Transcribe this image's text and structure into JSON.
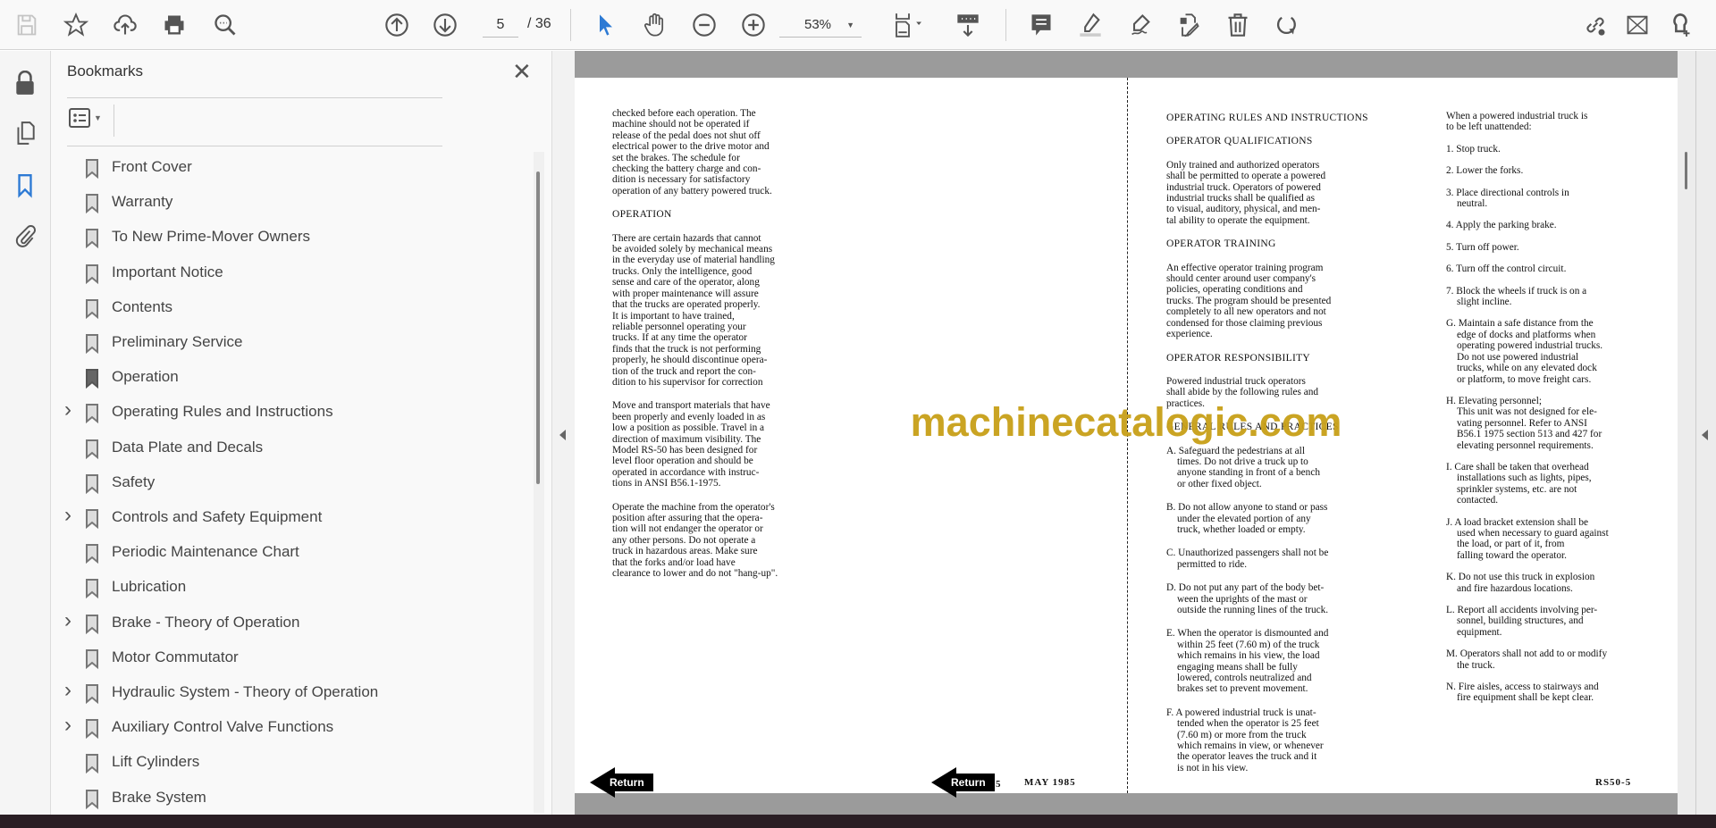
{
  "toolbar": {
    "page_current": "5",
    "page_total": "/ 36",
    "zoom": "53%"
  },
  "colors": {
    "accent": "#2d7ad4",
    "watermark": "#c8a018"
  },
  "panel": {
    "title": "Bookmarks",
    "bookmarks": [
      {
        "label": "Front Cover",
        "expandable": false
      },
      {
        "label": "Warranty",
        "expandable": false
      },
      {
        "label": "To New Prime-Mover Owners",
        "expandable": false
      },
      {
        "label": "Important Notice",
        "expandable": false
      },
      {
        "label": "Contents",
        "expandable": false
      },
      {
        "label": "Preliminary Service",
        "expandable": false
      },
      {
        "label": "Operation",
        "expandable": false,
        "current": true
      },
      {
        "label": "Operating Rules and Instructions",
        "expandable": true
      },
      {
        "label": "Data Plate and Decals",
        "expandable": false
      },
      {
        "label": "Safety",
        "expandable": false
      },
      {
        "label": "Controls and Safety Equipment",
        "expandable": true
      },
      {
        "label": "Periodic Maintenance Chart",
        "expandable": false
      },
      {
        "label": "Lubrication",
        "expandable": false
      },
      {
        "label": "Brake - Theory of Operation",
        "expandable": true
      },
      {
        "label": "Motor Commutator",
        "expandable": false
      },
      {
        "label": "Hydraulic System - Theory of Operation",
        "expandable": true
      },
      {
        "label": "Auxiliary Control Valve Functions",
        "expandable": true
      },
      {
        "label": "Lift Cylinders",
        "expandable": false
      },
      {
        "label": "Brake System",
        "expandable": false
      }
    ]
  },
  "document": {
    "watermark": "machinecatalogic.com",
    "return_label": "Return",
    "left_footer": "MAY 1985",
    "right_footer_partial": "5",
    "right_footer": "RS50-5",
    "left_page": [
      {
        "type": "p",
        "lines": [
          "checked before each operation. The",
          "machine should not be operated if",
          "release of the pedal does not shut off",
          "electrical power to the drive motor and",
          "set the brakes. The schedule for",
          "checking the battery charge and con-",
          "dition is necessary for satisfactory",
          "operation of any battery powered truck."
        ]
      },
      {
        "type": "h",
        "lines": [
          "OPERATION"
        ]
      },
      {
        "type": "p",
        "lines": [
          "There are certain hazards that cannot",
          "be avoided solely by mechanical means",
          "in the everyday use of material handling",
          "trucks. Only the intelligence, good",
          "sense and care of the operator, along",
          "with proper maintenance will assure",
          "that the trucks are operated properly.",
          "It is important to have trained,",
          "reliable personnel operating your",
          "trucks. If at any time the operator",
          "finds that the truck is not performing",
          "properly, he should discontinue opera-",
          "tion of the truck and report the con-",
          "dition to his supervisor for correction"
        ]
      },
      {
        "type": "p",
        "lines": [
          "Move and transport materials that have",
          "been properly and evenly loaded in as",
          "low a position as possible. Travel in a",
          "direction of maximum visibility. The",
          "Model RS-50 has been designed for",
          "level floor operation and should be",
          "operated in accordance with instruc-",
          "tions in ANSI B56.1-1975."
        ]
      },
      {
        "type": "p",
        "lines": [
          "Operate the machine from the operator's",
          "position after assuring that the opera-",
          "tion will not endanger the operator or",
          "any other persons. Do not operate a",
          "truck in hazardous areas. Make sure",
          "that the forks and/or load have",
          "clearance to lower and do not \"hang-up\"."
        ]
      }
    ],
    "right_col1": [
      {
        "type": "h",
        "lines": [
          "OPERATING RULES AND INSTRUCTIONS"
        ]
      },
      {
        "type": "h",
        "lines": [
          "OPERATOR QUALIFICATIONS"
        ]
      },
      {
        "type": "p",
        "lines": [
          "Only trained and authorized operators",
          "shall be permitted to operate a powered",
          "industrial truck.  Operators of powered",
          "industrial trucks shall be qualified as",
          "to visual, auditory, physical, and men-",
          "tal ability to operate the equipment."
        ]
      },
      {
        "type": "h",
        "lines": [
          "OPERATOR TRAINING"
        ]
      },
      {
        "type": "p",
        "lines": [
          "An effective operator training program",
          "should center around user company's",
          "policies, operating conditions and",
          "trucks. The program should be presented",
          "completely to all new operators and not",
          "condensed for those claiming previous",
          "experience."
        ]
      },
      {
        "type": "h",
        "lines": [
          "OPERATOR RESPONSIBILITY"
        ]
      },
      {
        "type": "p",
        "lines": [
          "Powered industrial truck operators",
          "shall abide by the following rules and",
          "practices."
        ]
      },
      {
        "type": "h",
        "lines": [
          "GENERAL RULES AND PRACTICES"
        ]
      },
      {
        "type": "i",
        "lines": [
          "A. Safeguard the pedestrians at all",
          "times. Do not drive a truck up to",
          "anyone standing in front of a bench",
          "or other fixed object."
        ]
      },
      {
        "type": "i",
        "lines": [
          "B. Do not allow anyone to stand or pass",
          "under the elevated portion of any",
          "truck, whether loaded or empty."
        ]
      },
      {
        "type": "i",
        "lines": [
          "C. Unauthorized passengers shall not be",
          "permitted to ride."
        ]
      },
      {
        "type": "i",
        "lines": [
          "D. Do not put any part of the body bet-",
          "ween the uprights of the mast or",
          "outside the running lines of the truck."
        ]
      },
      {
        "type": "i",
        "lines": [
          "E. When the operator is dismounted and",
          "within 25 feet (7.60 m) of the truck",
          "which remains in his view, the load",
          "engaging means shall be fully",
          "lowered, controls neutralized and",
          "brakes set to prevent movement."
        ]
      },
      {
        "type": "i",
        "lines": [
          "F. A powered industrial truck is unat-",
          "tended when the operator is 25 feet",
          "(7.60 m) or more from the truck",
          "which remains in view, or whenever",
          "the operator leaves the truck and it",
          "is not in his view."
        ]
      }
    ],
    "right_col2": [
      {
        "type": "p",
        "lines": [
          "When a powered industrial truck is",
          "to be left unattended:"
        ]
      },
      {
        "type": "i",
        "lines": [
          "1. Stop truck."
        ]
      },
      {
        "type": "i",
        "lines": [
          "2. Lower the forks."
        ]
      },
      {
        "type": "i",
        "lines": [
          "3. Place directional controls in",
          "neutral."
        ]
      },
      {
        "type": "i",
        "lines": [
          "4. Apply the parking brake."
        ]
      },
      {
        "type": "i",
        "lines": [
          "5. Turn off power."
        ]
      },
      {
        "type": "i",
        "lines": [
          "6. Turn off the control circuit."
        ]
      },
      {
        "type": "i",
        "lines": [
          "7. Block the wheels if truck is on a",
          "slight incline."
        ]
      },
      {
        "type": "i",
        "lines": [
          "G. Maintain a safe distance from the",
          "edge of docks and platforms when",
          "operating powered industrial trucks.",
          "Do not use powered industrial",
          "trucks, while on any elevated dock",
          "or platform, to move freight cars."
        ]
      },
      {
        "type": "i",
        "lines": [
          "H. Elevating personnel;",
          "This unit was not designed for ele-",
          "vating personnel. Refer to ANSI",
          "B56.1  1975 section 513 and 427 for",
          "elevating personnel requirements."
        ]
      },
      {
        "type": "i",
        "lines": [
          "I. Care shall be taken that overhead",
          "installations such as lights, pipes,",
          "sprinkler systems, etc. are not",
          "contacted."
        ]
      },
      {
        "type": "i",
        "lines": [
          "J. A load bracket extension shall be",
          "used when necessary to guard against",
          "the load, or part of it, from",
          "falling toward the operator."
        ]
      },
      {
        "type": "i",
        "lines": [
          "K. Do not use this truck in explosion",
          "and fire hazardous locations."
        ]
      },
      {
        "type": "i",
        "lines": [
          "L. Report all accidents involving per-",
          "sonnel, building structures, and",
          "equipment."
        ]
      },
      {
        "type": "i",
        "lines": [
          "M. Operators shall not add to or modify",
          "the truck."
        ]
      },
      {
        "type": "i",
        "lines": [
          "N. Fire aisles, access to stairways and",
          "fire equipment shall be kept clear."
        ]
      }
    ]
  }
}
